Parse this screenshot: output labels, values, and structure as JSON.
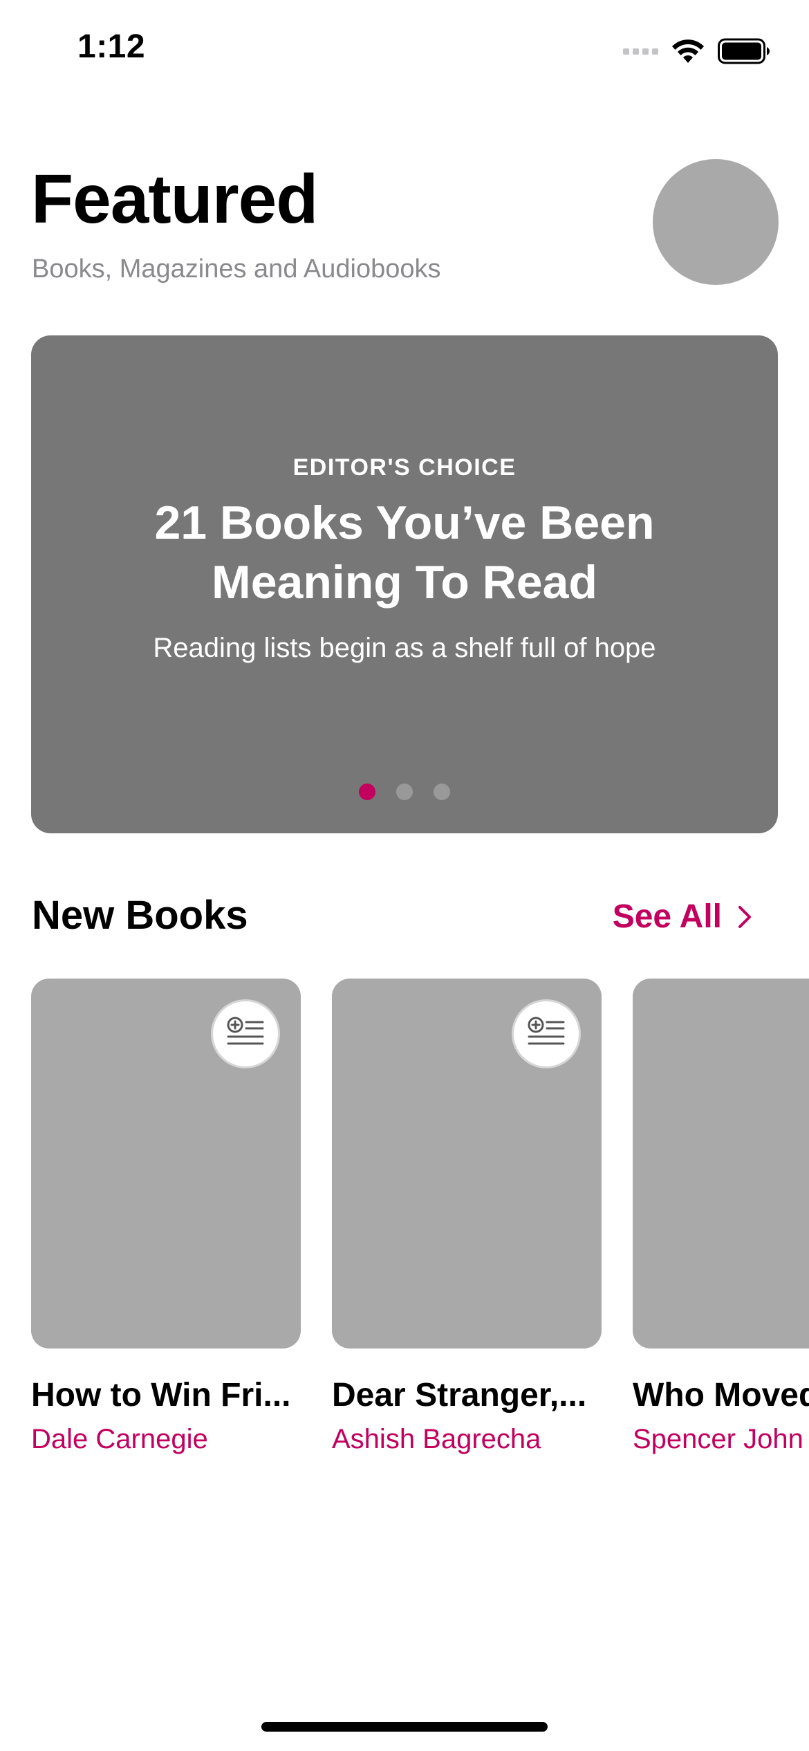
{
  "status_bar": {
    "time": "1:12"
  },
  "header": {
    "title": "Featured",
    "subtitle": "Books, Magazines and Audiobooks"
  },
  "featured": {
    "kicker": "EDITOR'S CHOICE",
    "title": "21 Books You’ve Been Meaning To Read",
    "description": "Reading lists begin as a shelf full of hope",
    "page_count": 3,
    "active_page": 1
  },
  "new_books": {
    "title": "New Books",
    "see_all_label": "See All",
    "items": [
      {
        "title": "How to Win Fri...",
        "author": "Dale Carnegie"
      },
      {
        "title": "Dear Stranger,...",
        "author": "Ashish Bagrecha"
      },
      {
        "title": "Who Moved",
        "author": "Spencer John"
      }
    ]
  },
  "colors": {
    "accent": "#c2005d",
    "placeholder": "#a9a9a9",
    "card": "#777777"
  },
  "icons": {
    "signal": "cellular-signal-icon",
    "wifi": "wifi-icon",
    "battery": "battery-icon",
    "add_to_list": "add-to-list-icon",
    "chevron": "chevron-right-icon"
  }
}
